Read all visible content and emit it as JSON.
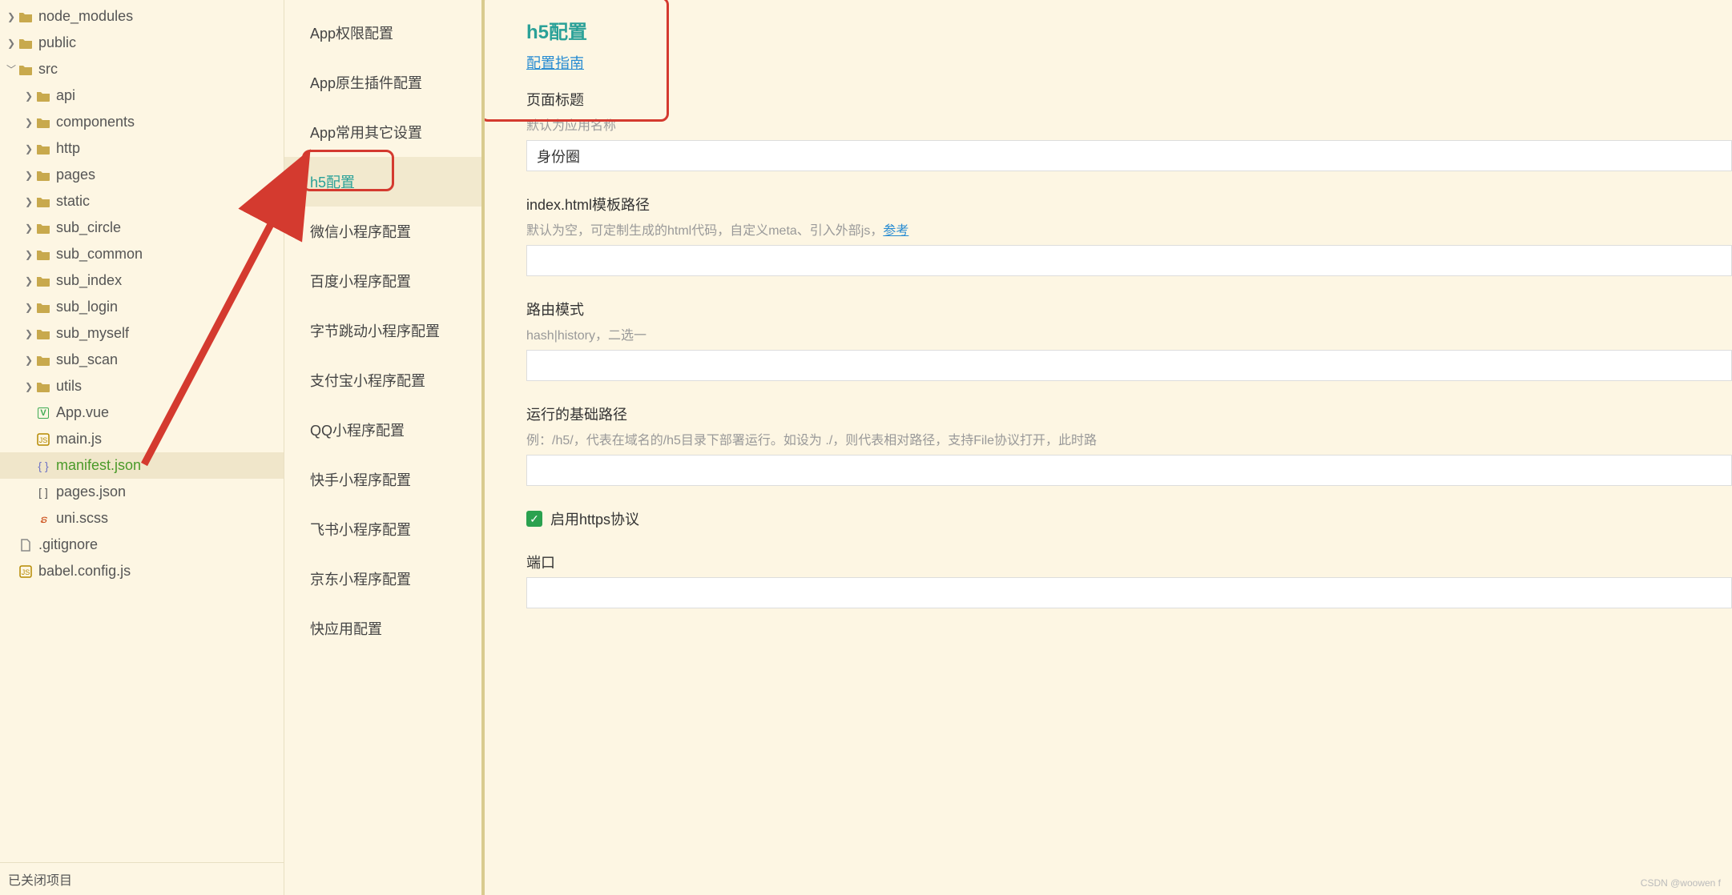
{
  "filetree": {
    "items": [
      {
        "depth": 0,
        "chev": "right",
        "type": "folder",
        "label": "node_modules"
      },
      {
        "depth": 0,
        "chev": "right",
        "type": "folder",
        "label": "public"
      },
      {
        "depth": 0,
        "chev": "down",
        "type": "folder",
        "label": "src"
      },
      {
        "depth": 1,
        "chev": "right",
        "type": "folder",
        "label": "api"
      },
      {
        "depth": 1,
        "chev": "right",
        "type": "folder",
        "label": "components"
      },
      {
        "depth": 1,
        "chev": "right",
        "type": "folder",
        "label": "http"
      },
      {
        "depth": 1,
        "chev": "right",
        "type": "folder",
        "label": "pages"
      },
      {
        "depth": 1,
        "chev": "right",
        "type": "folder",
        "label": "static"
      },
      {
        "depth": 1,
        "chev": "right",
        "type": "folder",
        "label": "sub_circle"
      },
      {
        "depth": 1,
        "chev": "right",
        "type": "folder",
        "label": "sub_common"
      },
      {
        "depth": 1,
        "chev": "right",
        "type": "folder",
        "label": "sub_index"
      },
      {
        "depth": 1,
        "chev": "right",
        "type": "folder",
        "label": "sub_login"
      },
      {
        "depth": 1,
        "chev": "right",
        "type": "folder",
        "label": "sub_myself"
      },
      {
        "depth": 1,
        "chev": "right",
        "type": "folder",
        "label": "sub_scan"
      },
      {
        "depth": 1,
        "chev": "right",
        "type": "folder",
        "label": "utils"
      },
      {
        "depth": 1,
        "chev": "",
        "type": "vue",
        "label": "App.vue"
      },
      {
        "depth": 1,
        "chev": "",
        "type": "js",
        "label": "main.js"
      },
      {
        "depth": 1,
        "chev": "",
        "type": "json",
        "label": "manifest.json",
        "selected": true
      },
      {
        "depth": 1,
        "chev": "",
        "type": "json-b",
        "label": "pages.json"
      },
      {
        "depth": 1,
        "chev": "",
        "type": "scss",
        "label": "uni.scss"
      },
      {
        "depth": 0,
        "chev": "",
        "type": "generic",
        "label": ".gitignore"
      },
      {
        "depth": 0,
        "chev": "",
        "type": "js",
        "label": "babel.config.js"
      }
    ],
    "footer": "已关闭项目"
  },
  "config_nav": {
    "items": [
      "App权限配置",
      "App原生插件配置",
      "App常用其它设置",
      "h5配置",
      "微信小程序配置",
      "百度小程序配置",
      "字节跳动小程序配置",
      "支付宝小程序配置",
      "QQ小程序配置",
      "快手小程序配置",
      "飞书小程序配置",
      "京东小程序配置",
      "快应用配置"
    ],
    "active_index": 3
  },
  "main": {
    "title": "h5配置",
    "guide_link": "配置指南",
    "fields": {
      "page_title": {
        "label": "页面标题",
        "hint": "默认为应用名称",
        "value": "身份圈"
      },
      "template_path": {
        "label": "index.html模板路径",
        "hint_prefix": "默认为空，可定制生成的html代码，自定义meta、引入外部js，",
        "hint_link": "参考",
        "value": ""
      },
      "router_mode": {
        "label": "路由模式",
        "hint": "hash|history，二选一",
        "value": ""
      },
      "base_path": {
        "label": "运行的基础路径",
        "hint": "例：/h5/，代表在域名的/h5目录下部署运行。如设为 ./，则代表相对路径，支持File协议打开，此时路",
        "value": ""
      },
      "https": {
        "label": "启用https协议",
        "checked": true
      },
      "port": {
        "label": "端口",
        "value": ""
      }
    }
  },
  "watermark": "CSDN @woowen f"
}
